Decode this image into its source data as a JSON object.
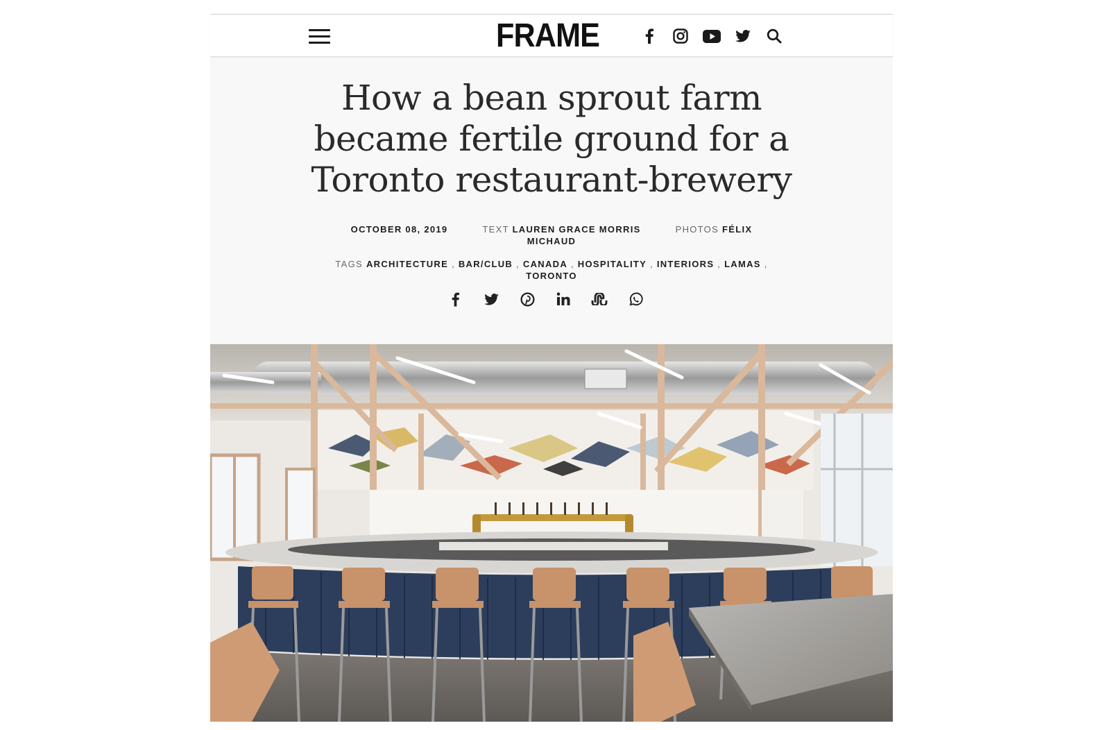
{
  "header": {
    "logo_text": "FRAME",
    "social_icons": [
      "facebook-icon",
      "instagram-icon",
      "youtube-icon",
      "twitter-icon",
      "search-icon"
    ]
  },
  "article": {
    "title": "How a bean sprout farm became fertile ground for a Toronto restaurant-brewery",
    "date": "OCTOBER 08, 2019",
    "text_label": "TEXT",
    "author": "LAUREN GRACE MORRIS",
    "photos_label": "PHOTOS",
    "photographer_first": "FÉLIX",
    "photographer_last": "MICHAUD",
    "tags_label": "TAGS",
    "tags": [
      "ARCHITECTURE",
      "BAR/CLUB",
      "CANADA",
      "HOSPITALITY",
      "INTERIORS",
      "LAMAS",
      "TORONTO"
    ],
    "share_icons": [
      "facebook-icon",
      "twitter-icon",
      "pinterest-icon",
      "linkedin-icon",
      "stumbleupon-icon",
      "whatsapp-icon"
    ]
  },
  "colors": {
    "text": "#222222",
    "hero_bg": "#f8f8f8",
    "bar_blue": "#2c3e5c",
    "wood": "#c8926a"
  }
}
